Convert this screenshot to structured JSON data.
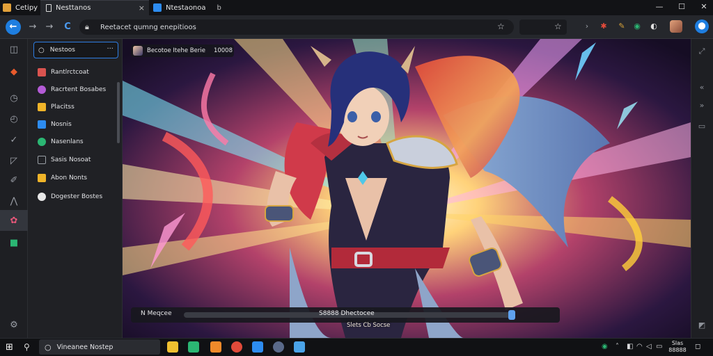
{
  "tabs": [
    {
      "label": "Cetipy",
      "color": "#e2a13a"
    },
    {
      "label": "Nesttanos",
      "color": "#ffffff"
    },
    {
      "label": "Ntestaonoa",
      "color": "#2d8cf0"
    }
  ],
  "tab_close": "×",
  "tab_suffix": "b",
  "window": {
    "minimize": "—",
    "maximize": "☐",
    "close": "✕"
  },
  "address": {
    "url": "Reetacet qumng enepitioos"
  },
  "toolbar": {
    "back": "←",
    "forward": "→",
    "reload": "C",
    "star": "☆",
    "chev": "›",
    "account": "⬤"
  },
  "side_panel": {
    "search_value": "Nestoos",
    "more": "···",
    "items": [
      {
        "label": "Rantlrctcoat",
        "color": "#d9534f"
      },
      {
        "label": "Racrtent Bosabes",
        "color": "#b45bd6"
      },
      {
        "label": "Placitss",
        "color": "#f0b429"
      },
      {
        "label": "Nosnis",
        "color": "#2d8cf0"
      },
      {
        "label": "Nasenlans",
        "color": "#2bb673"
      },
      {
        "label": "Sasis Nosoat",
        "color": "#9aa0a6"
      },
      {
        "label": "Abon Nonts",
        "color": "#f0b429"
      },
      {
        "label": "Dogester Bostes",
        "color": "#e8e8e8"
      }
    ]
  },
  "content": {
    "info_title": "Becotoe Itehe Berie",
    "info_value": "10008",
    "media_label": "N Meqcee",
    "media_status": "S8888 Dhectocee",
    "media_sub": "Slets Cb Socse",
    "progress": 0.99
  },
  "taskbar": {
    "search_text": "Vineanee Nostep",
    "clock_time": "Slas",
    "clock_date": "88888"
  }
}
